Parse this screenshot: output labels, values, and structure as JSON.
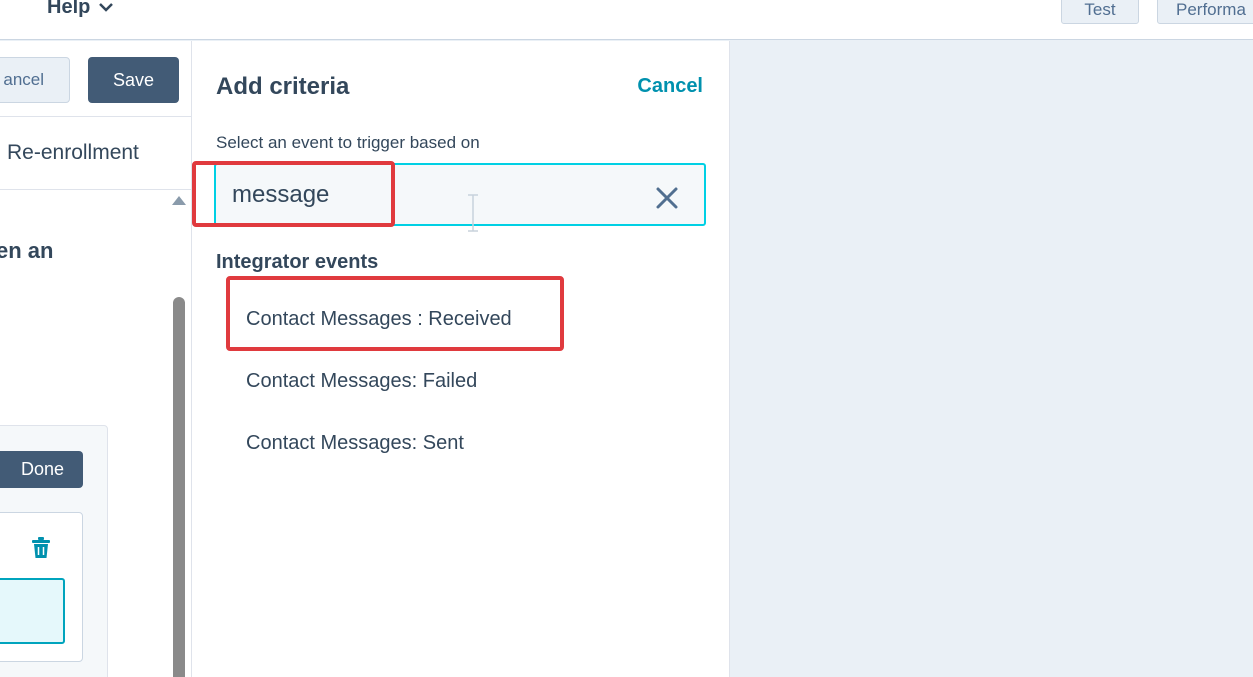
{
  "topbar": {
    "help_label": "Help",
    "test_label": "Test",
    "performance_label": "Performa"
  },
  "left_panel": {
    "cancel_label": "ancel",
    "save_label": "Save",
    "reenrollment_label": "Re-enrollment",
    "heading_fragment": "en an",
    "done_label": "Done"
  },
  "criteria_panel": {
    "title": "Add criteria",
    "cancel_label": "Cancel",
    "search_label": "Select an event to trigger based on",
    "search_value": "message",
    "group_title": "Integrator events",
    "options": [
      "Contact Messages : Received",
      "Contact Messages: Failed",
      "Contact Messages: Sent"
    ]
  },
  "colors": {
    "accent_teal": "#0091ae",
    "focus_cyan": "#00d0e4",
    "primary_button": "#425b76",
    "annotation_red": "#e03a3e",
    "text": "#33475b"
  },
  "icons": {
    "help_menu": "chevron-down-icon",
    "search_clear": "close-icon",
    "delete": "trash-icon",
    "scroll": "triangle-up-icon"
  }
}
